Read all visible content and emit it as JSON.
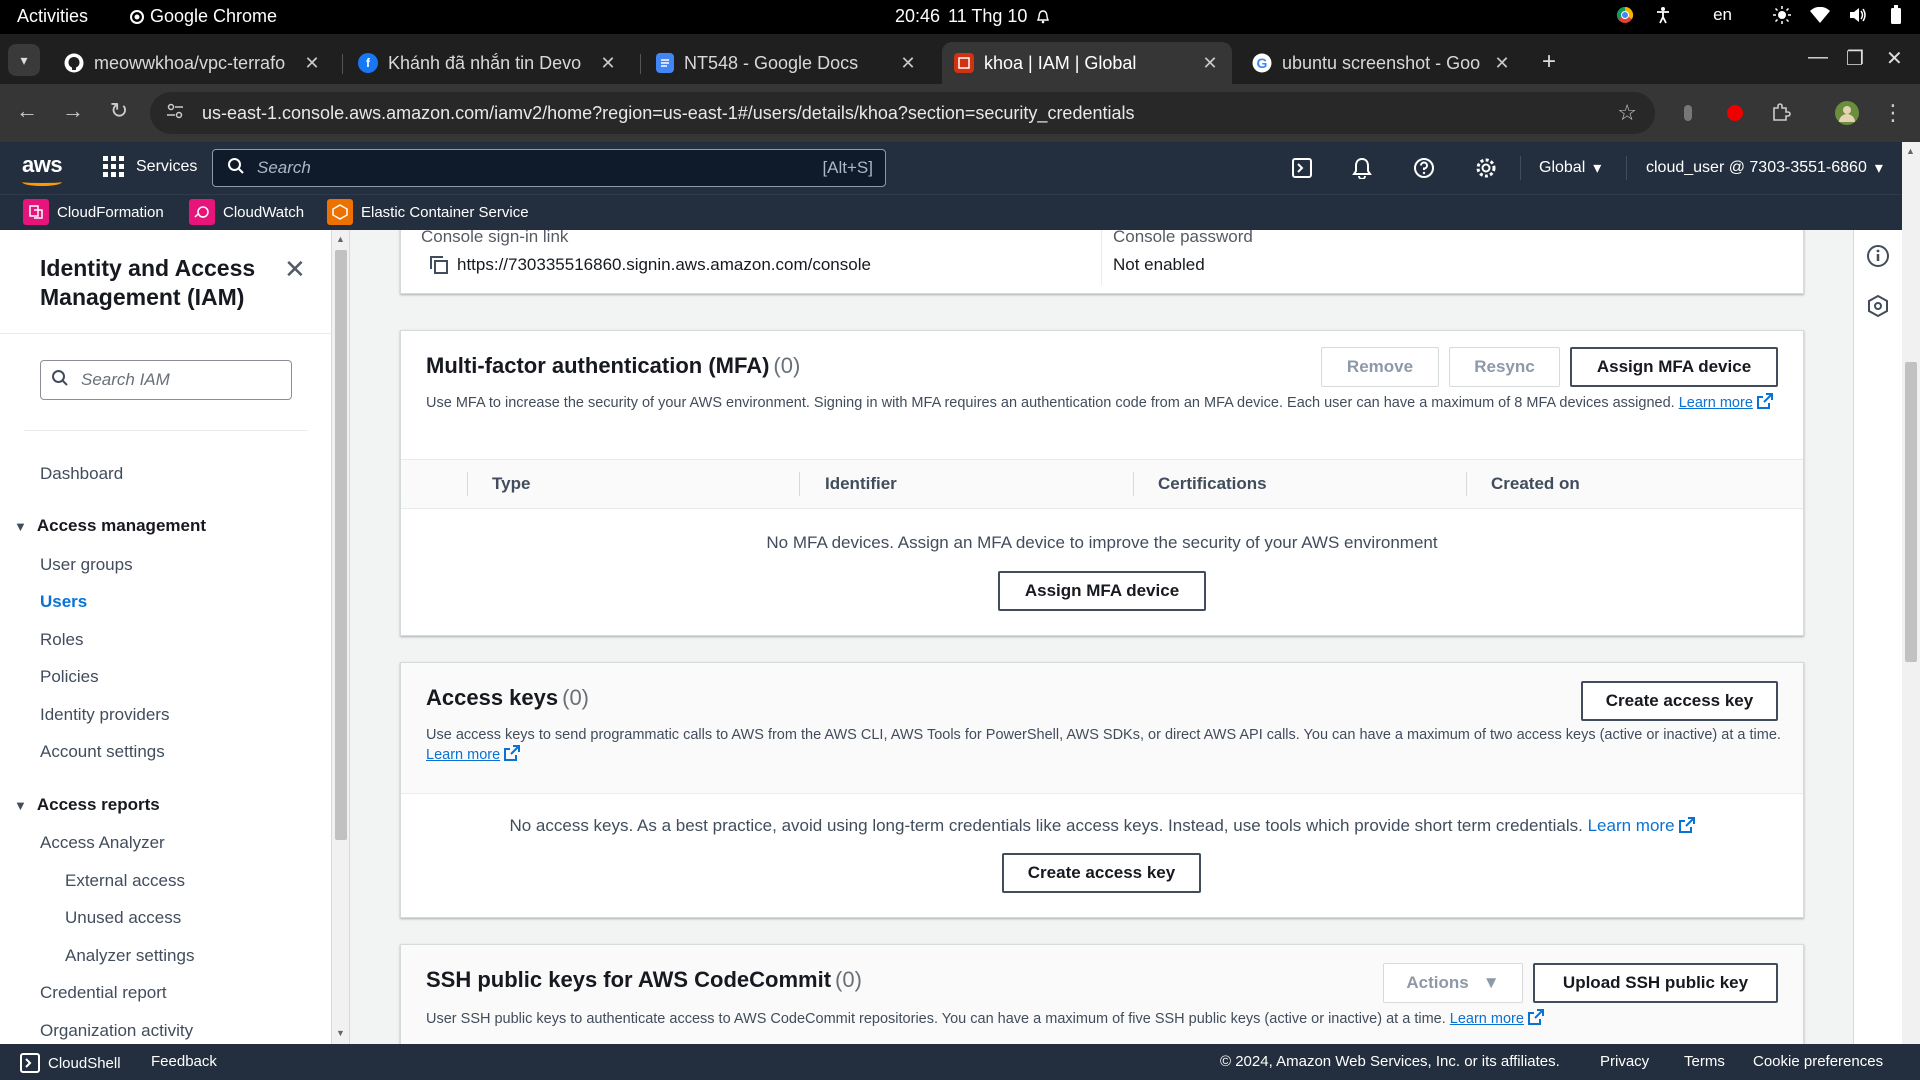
{
  "system_bar": {
    "activities": "Activities",
    "app_name": "Google Chrome",
    "date": "11 Thg 10",
    "time": "20:46",
    "lang": "en"
  },
  "browser": {
    "tabs": [
      {
        "title": "meowwkhoa/vpc-terrafo",
        "icon": "github-icon"
      },
      {
        "title": "Khánh đã nhắn tin Devo",
        "icon": "facebook-icon"
      },
      {
        "title": "NT548 - Google Docs",
        "icon": "google-docs-icon"
      },
      {
        "title": "khoa | IAM | Global",
        "icon": "aws-icon",
        "active": true
      },
      {
        "title": "ubuntu screenshot - Goo",
        "icon": "google-icon"
      }
    ],
    "url": "us-east-1.console.aws.amazon.com/iamv2/home?region=us-east-1#/users/details/khoa?section=security_credentials"
  },
  "aws_header": {
    "logo": "aws",
    "services_label": "Services",
    "search_placeholder": "Search",
    "search_shortcut": "[Alt+S]",
    "region": "Global",
    "account": "cloud_user @ 7303-3551-6860",
    "favorites": [
      {
        "label": "CloudFormation",
        "color": "#e7157b"
      },
      {
        "label": "CloudWatch",
        "color": "#e7157b"
      },
      {
        "label": "Elastic Container Service",
        "color": "#ed7100"
      }
    ]
  },
  "sidebar": {
    "title": "Identity and Access Management (IAM)",
    "search_placeholder": "Search IAM",
    "dashboard": "Dashboard",
    "access_management": {
      "label": "Access management",
      "items": [
        "User groups",
        "Users",
        "Roles",
        "Policies",
        "Identity providers",
        "Account settings"
      ]
    },
    "access_reports": {
      "label": "Access reports",
      "items": [
        "Access Analyzer",
        "External access",
        "Unused access",
        "Analyzer settings",
        "Credential report",
        "Organization activity"
      ]
    }
  },
  "console": {
    "signin_label": "Console sign-in link",
    "signin_url": "https://730335516860.signin.aws.amazon.com/console",
    "password_label": "Console password",
    "password_value": "Not enabled"
  },
  "mfa": {
    "title": "Multi-factor authentication (MFA)",
    "count": "(0)",
    "remove": "Remove",
    "resync": "Resync",
    "assign": "Assign MFA device",
    "desc": "Use MFA to increase the security of your AWS environment. Signing in with MFA requires an authentication code from an MFA device. Each user can have a maximum of 8 MFA devices assigned.",
    "learn": "Learn",
    "more": "more",
    "columns": [
      "Type",
      "Identifier",
      "Certifications",
      "Created on"
    ],
    "empty": "No MFA devices. Assign an MFA device to improve the security of your AWS environment",
    "empty_button": "Assign MFA device"
  },
  "access_keys": {
    "title": "Access keys",
    "count": "(0)",
    "create": "Create access key",
    "desc": "Use access keys to send programmatic calls to AWS from the AWS CLI, AWS Tools for PowerShell, AWS SDKs, or direct AWS API calls. You can have a maximum of two access keys (active or inactive) at a time.",
    "learn_more": "Learn more",
    "empty": "No access keys. As a best practice, avoid using long-term credentials like access keys. Instead, use tools which provide short term credentials.",
    "empty_learn_more": "Learn more",
    "empty_button": "Create access key"
  },
  "ssh": {
    "title": "SSH public keys for AWS CodeCommit",
    "count": "(0)",
    "actions": "Actions",
    "upload": "Upload SSH public key",
    "desc": "User SSH public keys to authenticate access to AWS CodeCommit repositories. You can have a maximum of five SSH public keys (active or inactive) at a time.",
    "learn_more": "Learn more"
  },
  "footer": {
    "cloudshell": "CloudShell",
    "feedback": "Feedback",
    "copyright": "© 2024, Amazon Web Services, Inc. or its affiliates.",
    "privacy": "Privacy",
    "terms": "Terms",
    "cookies": "Cookie preferences"
  }
}
